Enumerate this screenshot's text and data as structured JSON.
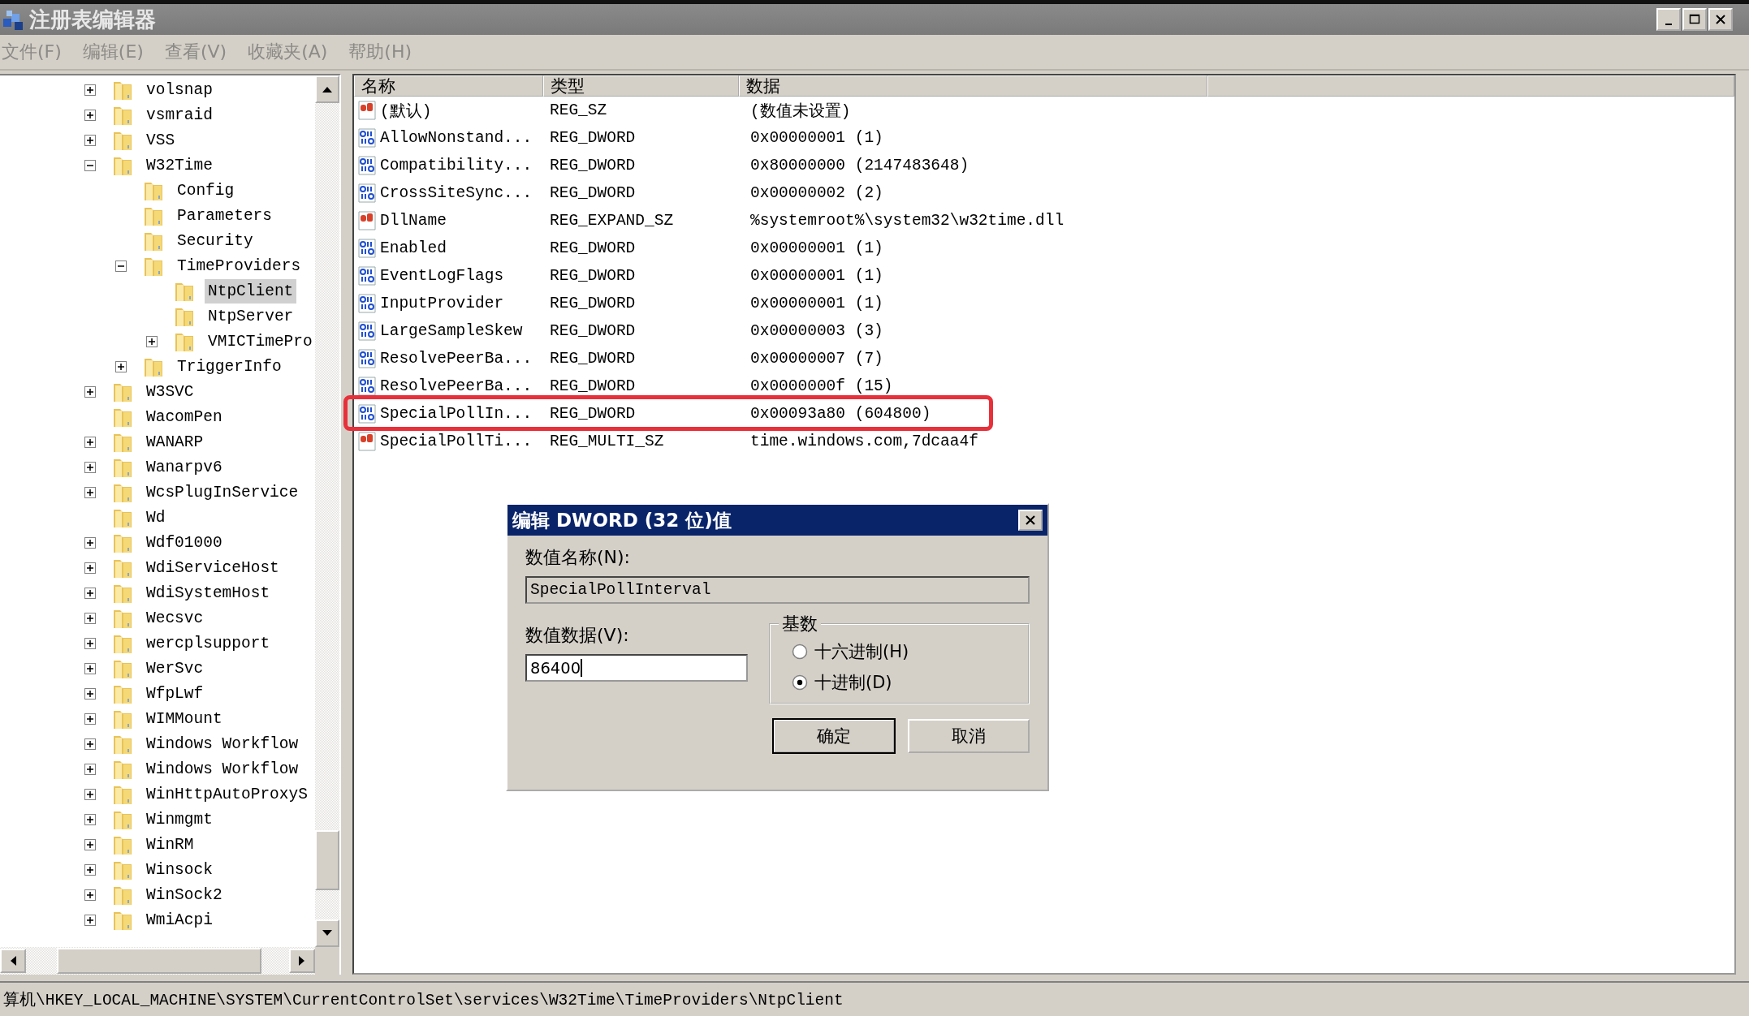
{
  "window": {
    "title": "注册表编辑器"
  },
  "menu": [
    {
      "label": "文件(F)"
    },
    {
      "label": "编辑(E)"
    },
    {
      "label": "查看(V)"
    },
    {
      "label": "收藏夹(A)"
    },
    {
      "label": "帮助(H)"
    }
  ],
  "tree": [
    {
      "label": "volsnap",
      "expandable": true,
      "expanded": false,
      "selected": false
    },
    {
      "label": "vsmraid",
      "expandable": true,
      "expanded": false,
      "selected": false
    },
    {
      "label": "VSS",
      "expandable": true,
      "expanded": false,
      "selected": false
    },
    {
      "label": "W32Time",
      "expandable": true,
      "expanded": true,
      "selected": false,
      "children": [
        {
          "label": "Config",
          "expandable": false,
          "selected": false
        },
        {
          "label": "Parameters",
          "expandable": false,
          "selected": false
        },
        {
          "label": "Security",
          "expandable": false,
          "selected": false
        },
        {
          "label": "TimeProviders",
          "expandable": true,
          "expanded": true,
          "selected": false,
          "children": [
            {
              "label": "NtpClient",
              "expandable": false,
              "selected": true
            },
            {
              "label": "NtpServer",
              "expandable": false,
              "selected": false
            },
            {
              "label": "VMICTimePro",
              "expandable": true,
              "expanded": false,
              "selected": false
            }
          ]
        },
        {
          "label": "TriggerInfo",
          "expandable": true,
          "expanded": false,
          "selected": false
        }
      ]
    },
    {
      "label": "W3SVC",
      "expandable": true,
      "expanded": false,
      "selected": false
    },
    {
      "label": "WacomPen",
      "expandable": false,
      "selected": false
    },
    {
      "label": "WANARP",
      "expandable": true,
      "expanded": false,
      "selected": false
    },
    {
      "label": "Wanarpv6",
      "expandable": true,
      "expanded": false,
      "selected": false
    },
    {
      "label": "WcsPlugInService",
      "expandable": true,
      "expanded": false,
      "selected": false
    },
    {
      "label": "Wd",
      "expandable": false,
      "selected": false
    },
    {
      "label": "Wdf01000",
      "expandable": true,
      "expanded": false,
      "selected": false
    },
    {
      "label": "WdiServiceHost",
      "expandable": true,
      "expanded": false,
      "selected": false
    },
    {
      "label": "WdiSystemHost",
      "expandable": true,
      "expanded": false,
      "selected": false
    },
    {
      "label": "Wecsvc",
      "expandable": true,
      "expanded": false,
      "selected": false
    },
    {
      "label": "wercplsupport",
      "expandable": true,
      "expanded": false,
      "selected": false
    },
    {
      "label": "WerSvc",
      "expandable": true,
      "expanded": false,
      "selected": false
    },
    {
      "label": "WfpLwf",
      "expandable": true,
      "expanded": false,
      "selected": false
    },
    {
      "label": "WIMMount",
      "expandable": true,
      "expanded": false,
      "selected": false
    },
    {
      "label": "Windows Workflow",
      "expandable": true,
      "expanded": false,
      "selected": false
    },
    {
      "label": "Windows Workflow",
      "expandable": true,
      "expanded": false,
      "selected": false
    },
    {
      "label": "WinHttpAutoProxyS",
      "expandable": true,
      "expanded": false,
      "selected": false
    },
    {
      "label": "Winmgmt",
      "expandable": true,
      "expanded": false,
      "selected": false
    },
    {
      "label": "WinRM",
      "expandable": true,
      "expanded": false,
      "selected": false
    },
    {
      "label": "Winsock",
      "expandable": true,
      "expanded": false,
      "selected": false
    },
    {
      "label": "WinSock2",
      "expandable": true,
      "expanded": false,
      "selected": false
    },
    {
      "label": "WmiAcpi",
      "expandable": true,
      "expanded": false,
      "selected": false
    }
  ],
  "table": {
    "columns": [
      "名称",
      "类型",
      "数据"
    ],
    "rows": [
      {
        "kind": "string",
        "name": "(默认)",
        "type": "REG_SZ",
        "data": "(数值未设置)",
        "highlighted": false
      },
      {
        "kind": "dword",
        "name": "AllowNonstand...",
        "type": "REG_DWORD",
        "data": "0x00000001 (1)",
        "highlighted": false
      },
      {
        "kind": "dword",
        "name": "Compatibility...",
        "type": "REG_DWORD",
        "data": "0x80000000 (2147483648)",
        "highlighted": false
      },
      {
        "kind": "dword",
        "name": "CrossSiteSync...",
        "type": "REG_DWORD",
        "data": "0x00000002 (2)",
        "highlighted": false
      },
      {
        "kind": "string",
        "name": "DllName",
        "type": "REG_EXPAND_SZ",
        "data": "%systemroot%\\system32\\w32time.dll",
        "highlighted": false
      },
      {
        "kind": "dword",
        "name": "Enabled",
        "type": "REG_DWORD",
        "data": "0x00000001 (1)",
        "highlighted": false
      },
      {
        "kind": "dword",
        "name": "EventLogFlags",
        "type": "REG_DWORD",
        "data": "0x00000001 (1)",
        "highlighted": false
      },
      {
        "kind": "dword",
        "name": "InputProvider",
        "type": "REG_DWORD",
        "data": "0x00000001 (1)",
        "highlighted": false
      },
      {
        "kind": "dword",
        "name": "LargeSampleSkew",
        "type": "REG_DWORD",
        "data": "0x00000003 (3)",
        "highlighted": false
      },
      {
        "kind": "dword",
        "name": "ResolvePeerBa...",
        "type": "REG_DWORD",
        "data": "0x00000007 (7)",
        "highlighted": false
      },
      {
        "kind": "dword",
        "name": "ResolvePeerBa...",
        "type": "REG_DWORD",
        "data": "0x0000000f (15)",
        "highlighted": false
      },
      {
        "kind": "dword",
        "name": "SpecialPollIn...",
        "type": "REG_DWORD",
        "data": "0x00093a80 (604800)",
        "highlighted": true
      },
      {
        "kind": "string",
        "name": "SpecialPollTi...",
        "type": "REG_MULTI_SZ",
        "data": "time.windows.com,7dcaa4f",
        "highlighted": false
      }
    ]
  },
  "dialog": {
    "title": "编辑 DWORD (32 位)值",
    "name_label": "数值名称(N):",
    "name_value": "SpecialPollInterval",
    "data_label": "数值数据(V):",
    "data_value": "86400",
    "base_label": "基数",
    "radios": [
      {
        "label": "十六进制(H)",
        "selected": false
      },
      {
        "label": "十进制(D)",
        "selected": true
      }
    ],
    "buttons": [
      {
        "label": "确定",
        "default": true
      },
      {
        "label": "取消",
        "default": false
      }
    ]
  },
  "status_bar": "算机\\HKEY_LOCAL_MACHINE\\SYSTEM\\CurrentControlSet\\services\\W32Time\\TimeProviders\\NtpClient"
}
